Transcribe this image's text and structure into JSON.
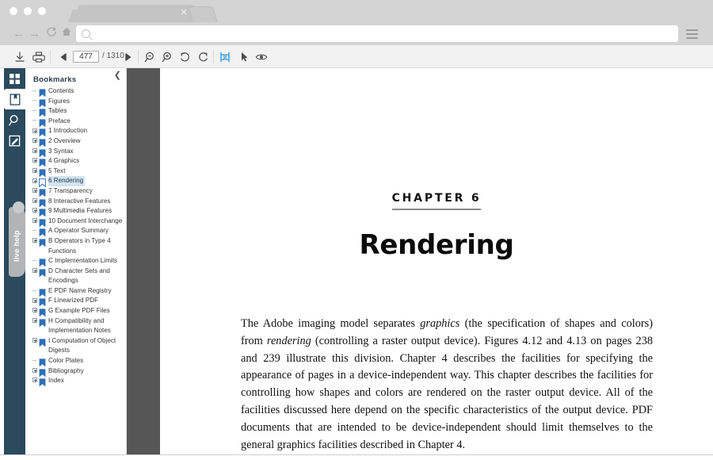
{
  "browser": {
    "tab": {
      "title": "",
      "close_icon": "close-icon"
    },
    "new_tab_label": "",
    "nav": {
      "back": "←",
      "forward": "→",
      "reload": "↻",
      "home": "⌂"
    },
    "address": {
      "value": "",
      "placeholder": ""
    },
    "menu_icon": "hamburger-menu-icon"
  },
  "pdf_toolbar": {
    "download_label": "Download",
    "print_label": "Print",
    "prev_page_label": "Previous page",
    "page_number": "477",
    "page_total": "/ 1310",
    "next_page_label": "Next page",
    "zoom_out_label": "Zoom out",
    "zoom_in_label": "Zoom in",
    "rotate_ccw_label": "Rotate counterclockwise",
    "rotate_cw_label": "Rotate clockwise",
    "fit_width_label": "Fit width",
    "select_tool_label": "Select",
    "view_tool_label": "View",
    "active_tool": "fit-width",
    "accent_color": "#4aa3e0"
  },
  "sidebar": {
    "rail": [
      {
        "name": "thumbnails",
        "icon": "grid-icon",
        "active": false
      },
      {
        "name": "bookmarks",
        "icon": "bookmark-page-icon",
        "active": true
      },
      {
        "name": "search",
        "icon": "search-icon",
        "active": false
      },
      {
        "name": "annotate",
        "icon": "edit-pencil-icon",
        "active": false
      }
    ],
    "live_help": {
      "label": "live help"
    },
    "panel": {
      "title": "Bookmarks",
      "collapse_icon": "chevron-left-icon",
      "items": [
        {
          "label": "Contents",
          "expandable": false,
          "selected": false
        },
        {
          "label": "Figures",
          "expandable": false,
          "selected": false
        },
        {
          "label": "Tables",
          "expandable": false,
          "selected": false
        },
        {
          "label": "Preface",
          "expandable": false,
          "selected": false
        },
        {
          "label": "1 Introduction",
          "expandable": true,
          "selected": false
        },
        {
          "label": "2 Overview",
          "expandable": true,
          "selected": false
        },
        {
          "label": "3 Syntax",
          "expandable": true,
          "selected": false
        },
        {
          "label": "4 Graphics",
          "expandable": true,
          "selected": false
        },
        {
          "label": "5 Text",
          "expandable": true,
          "selected": false
        },
        {
          "label": "6 Rendering",
          "expandable": true,
          "selected": true
        },
        {
          "label": "7 Transparency",
          "expandable": true,
          "selected": false
        },
        {
          "label": "8 Interactive Features",
          "expandable": true,
          "selected": false
        },
        {
          "label": "9 Multimedia Features",
          "expandable": true,
          "selected": false
        },
        {
          "label": "10 Document Interchange",
          "expandable": true,
          "selected": false
        },
        {
          "label": "A Operator Summary",
          "expandable": false,
          "selected": false
        },
        {
          "label": "B Operators in Type 4 Functions",
          "expandable": true,
          "selected": false
        },
        {
          "label": "C Implementation Limits",
          "expandable": false,
          "selected": false
        },
        {
          "label": "D Character Sets and Encodings",
          "expandable": true,
          "selected": false
        },
        {
          "label": "E PDF Name Registry",
          "expandable": false,
          "selected": false
        },
        {
          "label": "F Linearized PDF",
          "expandable": true,
          "selected": false
        },
        {
          "label": "G Example PDF Files",
          "expandable": true,
          "selected": false
        },
        {
          "label": "H Compatibility and Implementation Notes",
          "expandable": true,
          "selected": false
        },
        {
          "label": "I Computation of Object Digests",
          "expandable": true,
          "selected": false
        },
        {
          "label": "Color Plates",
          "expandable": false,
          "selected": false
        },
        {
          "label": "Bibliography",
          "expandable": true,
          "selected": false
        },
        {
          "label": "Index",
          "expandable": true,
          "selected": false
        }
      ]
    }
  },
  "document": {
    "chapter_eyebrow": "CHAPTER 6",
    "chapter_title": "Rendering",
    "paragraph_parts": {
      "p1": "The Adobe imaging model separates ",
      "i1": "graphics",
      "p2": " (the specification of shapes and colors) from ",
      "i2": "rendering",
      "p3": " (controlling a raster output device). Figures 4.12 and 4.13 on pages 238 and 239 illustrate this division. Chapter 4 describes the facilities for specifying the appearance of pages in a device-independent way. This chapter describes the facilities for controlling how shapes and colors are rendered on the raster output device. All of the facilities discussed here depend on the specific characteristics of the output device. PDF documents that are intended to be device-independent should limit themselves to the general graphics facilities described in Chapter 4."
    }
  }
}
